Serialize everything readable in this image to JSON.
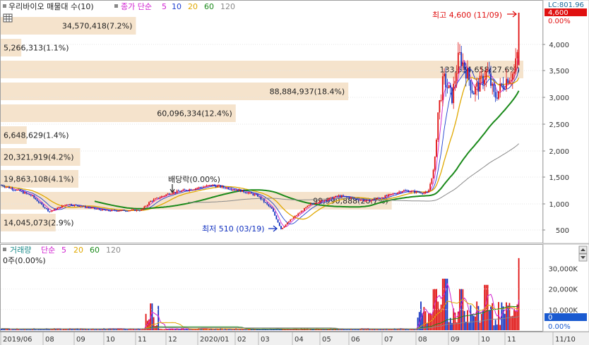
{
  "top_legend": {
    "title": "우리바이오 매물대 수(10)",
    "ma_label": "종가 단순",
    "ma_periods": [
      "5",
      "10",
      "20",
      "60",
      "120"
    ],
    "ma_colors": [
      "#d020d0",
      "#1f3fd0",
      "#e0a800",
      "#1a8a1a",
      "#8a8a8a"
    ]
  },
  "right_labels": {
    "lc": "LC:801.96",
    "current_price": "4,600",
    "current_pct": "0.00%"
  },
  "volume_legend": {
    "title": "거래량",
    "ma_label": "단순",
    "ma_periods": [
      "5",
      "20",
      "60",
      "120"
    ],
    "ma_colors": [
      "#d020d0",
      "#e0a800",
      "#1a8a1a",
      "#8a8a8a"
    ],
    "zero_label": "0주(0.00%)",
    "current_value": "0",
    "current_pct": "0.00%"
  },
  "annotations": {
    "high": "최고 4,600 (11/09)",
    "low": "최저 510 (03/19)",
    "dividend": "배당락(0.00%)"
  },
  "x_labels": [
    "2019/06",
    "08",
    "09",
    "10",
    "11",
    "12",
    "2020/01",
    "02",
    "03",
    "04",
    "05",
    "06",
    "07",
    "08",
    "09",
    "10",
    "11",
    "11/10"
  ],
  "chart_data": [
    {
      "type": "candlestick",
      "title": "우리바이오",
      "price_yticks": [
        500,
        1000,
        1500,
        2000,
        2500,
        3000,
        3500,
        4000
      ],
      "ylim": [
        300,
        4800
      ],
      "volume_profile": {
        "label": "매물대 수(10)",
        "bins": [
          {
            "price": 4350,
            "volume": 34570418,
            "label": "34,570,418(7.2%)"
          },
          {
            "price": 3950,
            "volume": 5266313,
            "label": "5,266,313(1.1%)"
          },
          {
            "price": 3550,
            "volume": 133634658,
            "label": "133,634,658(27.6%)"
          },
          {
            "price": 3150,
            "volume": 88884937,
            "label": "88,884,937(18.4%)"
          },
          {
            "price": 2750,
            "volume": 60096334,
            "label": "60,096,334(12.4%)"
          },
          {
            "price": 2350,
            "volume": 6648629,
            "label": "6,648,629(1.4%)"
          },
          {
            "price": 1950,
            "volume": 20321919,
            "label": "20,321,919(4.2%)"
          },
          {
            "price": 1550,
            "volume": 19863108,
            "label": "19,863,108(4.1%)"
          },
          {
            "price": 1150,
            "volume": 99990888,
            "label": "99,990,888(20.7%)"
          },
          {
            "price": 750,
            "volume": 14045073,
            "label": "14,045,073(2.9%)"
          }
        ]
      },
      "highlights": [
        {
          "label": "최고",
          "date": "11/09",
          "price": 4600
        },
        {
          "label": "최저",
          "date": "03/19",
          "price": 510
        }
      ],
      "moving_averages": [
        "5",
        "10",
        "20",
        "60",
        "120"
      ]
    },
    {
      "type": "bar",
      "title": "거래량",
      "volume_yticks": [
        "10,000K",
        "20,000K",
        "30,000K"
      ],
      "ylim": [
        0,
        37000
      ],
      "moving_averages": [
        "5",
        "20",
        "60",
        "120"
      ]
    }
  ]
}
